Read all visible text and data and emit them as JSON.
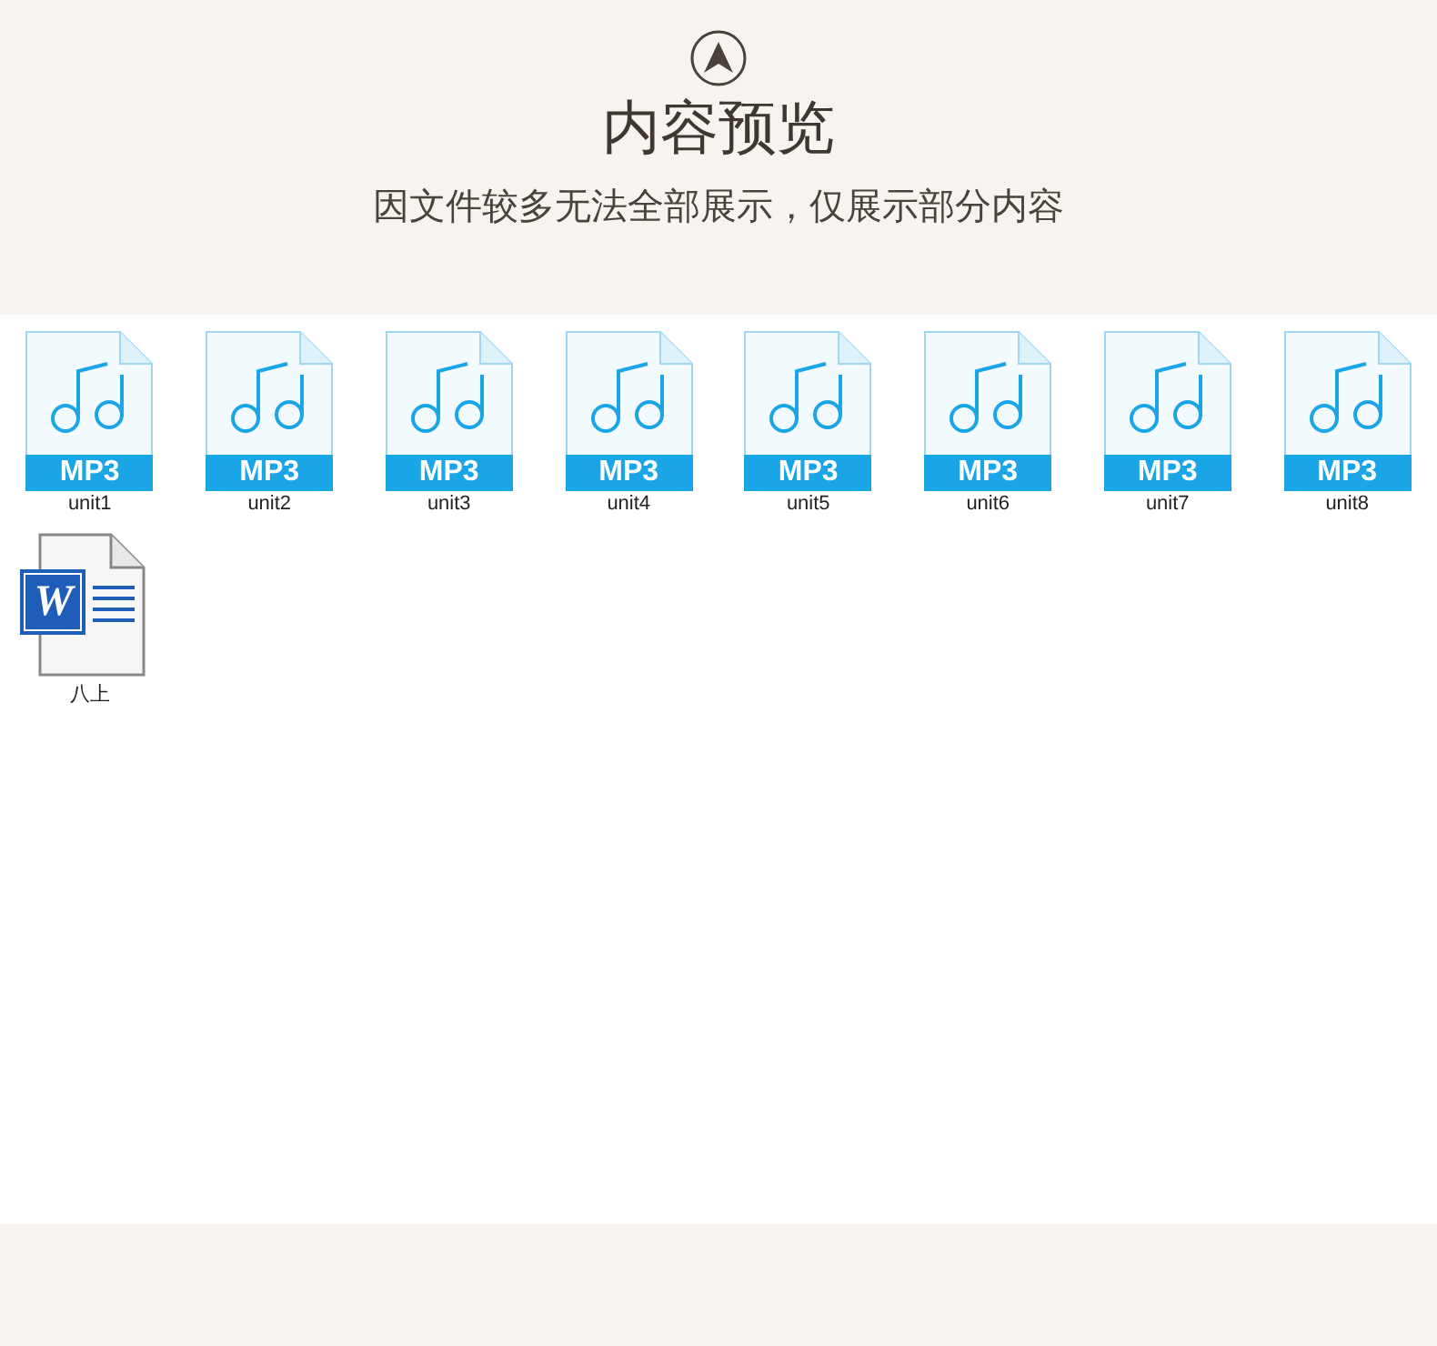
{
  "header": {
    "title": "内容预览",
    "subtitle": "因文件较多无法全部展示，仅展示部分内容"
  },
  "files": [
    {
      "kind": "mp3",
      "badge": "MP3",
      "name": "unit1"
    },
    {
      "kind": "mp3",
      "badge": "MP3",
      "name": "unit2"
    },
    {
      "kind": "mp3",
      "badge": "MP3",
      "name": "unit3"
    },
    {
      "kind": "mp3",
      "badge": "MP3",
      "name": "unit4"
    },
    {
      "kind": "mp3",
      "badge": "MP3",
      "name": "unit5"
    },
    {
      "kind": "mp3",
      "badge": "MP3",
      "name": "unit6"
    },
    {
      "kind": "mp3",
      "badge": "MP3",
      "name": "unit7"
    },
    {
      "kind": "mp3",
      "badge": "MP3",
      "name": "unit8"
    },
    {
      "kind": "word",
      "badge": "W",
      "name": "八上"
    }
  ]
}
